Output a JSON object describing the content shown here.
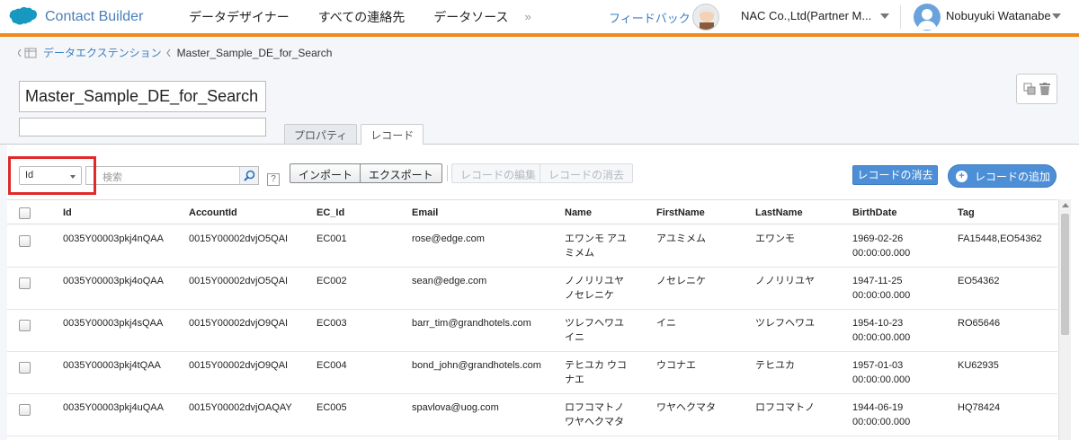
{
  "app": {
    "name": "Contact Builder"
  },
  "nav": {
    "items": [
      "データデザイナー",
      "すべての連絡先",
      "データソース"
    ],
    "more": "»"
  },
  "header": {
    "feedback": "フィードバック",
    "org": "NAC Co.,Ltd(Partner M...",
    "user": "Nobuyuki Watanabe"
  },
  "breadcrumb": {
    "parent": "データエクステンション",
    "current": "Master_Sample_DE_for_Search"
  },
  "title": {
    "name": "Master_Sample_DE_for_Search",
    "description": ""
  },
  "tabs": [
    {
      "label": "プロパティ",
      "active": false
    },
    {
      "label": "レコード",
      "active": true
    }
  ],
  "toolbar": {
    "field_select": "Id",
    "search_placeholder": "検索",
    "help": "?",
    "import": "インポート",
    "export": "エクスポート",
    "edit": "レコードの編集",
    "delete_disabled": "レコードの消去",
    "delete": "レコードの消去",
    "add": "レコードの追加"
  },
  "table": {
    "columns": [
      "Id",
      "AccountId",
      "EC_Id",
      "Email",
      "Name",
      "FirstName",
      "LastName",
      "BirthDate",
      "Tag"
    ],
    "rows": [
      {
        "id": "0035Y00003pkj4nQAA",
        "account": "0015Y00002dvjO5QAI",
        "ec": "EC001",
        "email": "rose@edge.com",
        "name1": "エワンモ アユ",
        "name2": "ミメム",
        "first": "アユミメム",
        "last": "エワンモ",
        "date": "1969-02-26",
        "time": "00:00:00.000",
        "tag": "FA15448,EO54362"
      },
      {
        "id": "0035Y00003pkj4oQAA",
        "account": "0015Y00002dvjO5QAI",
        "ec": "EC002",
        "email": "sean@edge.com",
        "name1": "ノノリリユヤ",
        "name2": "ノセレニケ",
        "first": "ノセレニケ",
        "last": "ノノリリユヤ",
        "date": "1947-11-25",
        "time": "00:00:00.000",
        "tag": "EO54362"
      },
      {
        "id": "0035Y00003pkj4sQAA",
        "account": "0015Y00002dvjO9QAI",
        "ec": "EC003",
        "email": "barr_tim@grandhotels.com",
        "name1": "ツレフヘワユ",
        "name2": "イニ",
        "first": "イニ",
        "last": "ツレフヘワユ",
        "date": "1954-10-23",
        "time": "00:00:00.000",
        "tag": "RO65646"
      },
      {
        "id": "0035Y00003pkj4tQAA",
        "account": "0015Y00002dvjO9QAI",
        "ec": "EC004",
        "email": "bond_john@grandhotels.com",
        "name1": "テヒユカ ウコ",
        "name2": "ナエ",
        "first": "ウコナエ",
        "last": "テヒユカ",
        "date": "1957-01-03",
        "time": "00:00:00.000",
        "tag": "KU62935"
      },
      {
        "id": "0035Y00003pkj4uQAA",
        "account": "0015Y00002dvjOAQAY",
        "ec": "EC005",
        "email": "spavlova@uog.com",
        "name1": "ロフコマトノ",
        "name2": "ワヤヘクマタ",
        "first": "ワヤヘクマタ",
        "last": "ロフコマトノ",
        "date": "1944-06-19",
        "time": "00:00:00.000",
        "tag": "HQ78424"
      }
    ]
  }
}
